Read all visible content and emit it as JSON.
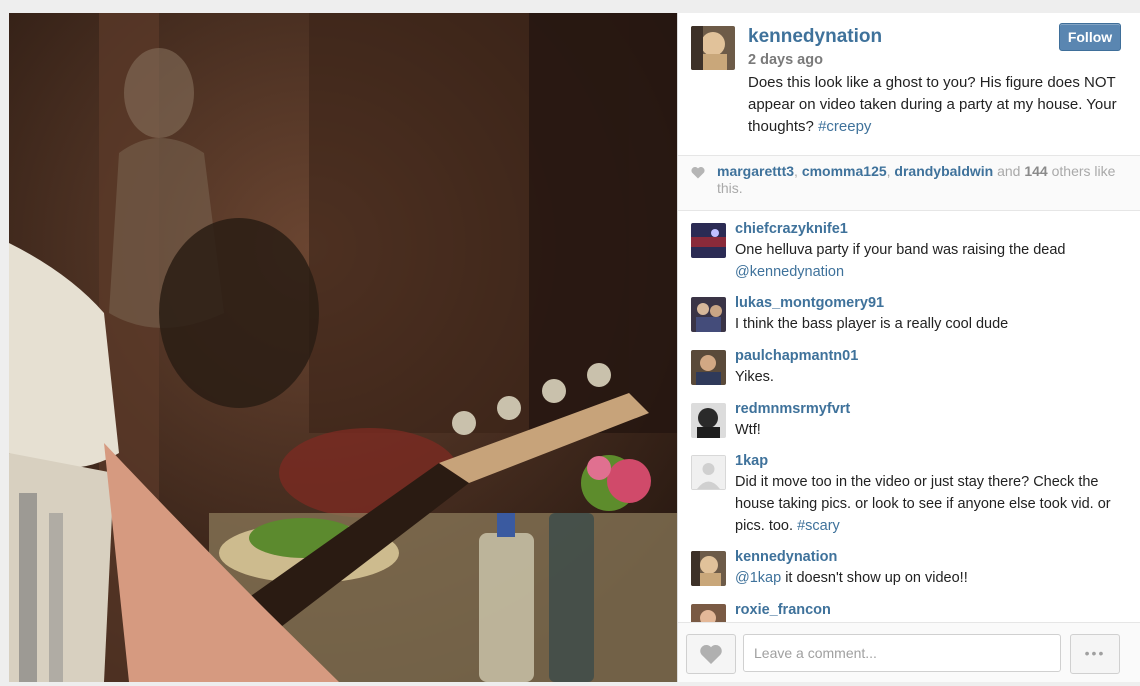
{
  "post": {
    "owner": "kennedynation",
    "time": "2 days ago",
    "caption_text": "Does this look like a ghost to you? His figure does NOT appear on video taken during a party at my house. Your thoughts?",
    "caption_hashtag": "#creepy",
    "follow_label": "Follow"
  },
  "likes": {
    "users": [
      "margarettt3",
      "cmomma125",
      "drandybaldwin"
    ],
    "sep": ", ",
    "and": " and ",
    "count": "144",
    "suffix": " others like this."
  },
  "comments": [
    {
      "user": "chiefcrazyknife1",
      "text": "One helluva party if your band was raising the dead",
      "mention": "@kennedynation"
    },
    {
      "user": "lukas_montgomery91",
      "text": "I think the bass player is a really cool dude"
    },
    {
      "user": "paulchapmantn01",
      "text": "Yikes."
    },
    {
      "user": "redmnmsrmyfvrt",
      "text": "Wtf!"
    },
    {
      "user": "1kap",
      "text": "Did it move too in the video or just stay there? Check the house taking pics. or look to see if anyone else took vid. or pics. too.",
      "hashtag": "#scary"
    },
    {
      "user": "kennedynation",
      "mention": "@1kap",
      "text": " it doesn't show up on video!!"
    },
    {
      "user": "roxie_francon"
    }
  ],
  "footer": {
    "placeholder": "Leave a comment...",
    "more_label": "•••"
  },
  "colors": {
    "link": "#3f729b",
    "follow_button": "#5a86b1"
  },
  "icons": [
    "heart-icon",
    "more-options-icon"
  ]
}
